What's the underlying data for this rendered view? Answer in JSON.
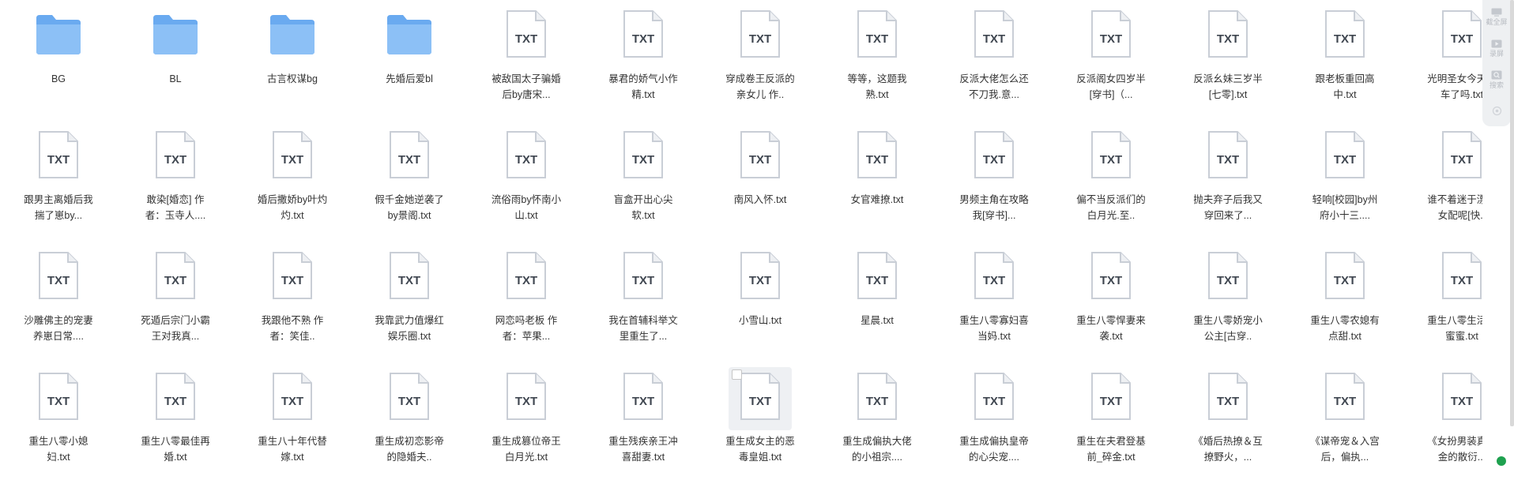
{
  "colors": {
    "folder": "#6aaaf0",
    "txt_text": "#3f4650",
    "doc_stroke": "#c9ced6"
  },
  "items": [
    {
      "type": "folder",
      "name": "BG"
    },
    {
      "type": "folder",
      "name": "BL"
    },
    {
      "type": "folder",
      "name": "古言权谋bg"
    },
    {
      "type": "folder",
      "name": "先婚后爱bl"
    },
    {
      "type": "txt",
      "name": "被敌国太子骗婚后by唐宋..."
    },
    {
      "type": "txt",
      "name": "暴君的娇气小作精.txt"
    },
    {
      "type": "txt",
      "name": "穿成卷王反派的亲女儿 作.."
    },
    {
      "type": "txt",
      "name": "等等，这题我熟.txt"
    },
    {
      "type": "txt",
      "name": "反派大佬怎么还不刀我.意..."
    },
    {
      "type": "txt",
      "name": "反派阁女四岁半[穿书]（..."
    },
    {
      "type": "txt",
      "name": "反派幺妹三岁半[七零].txt"
    },
    {
      "type": "txt",
      "name": "跟老板重回高中.txt"
    },
    {
      "type": "txt",
      "name": "光明圣女今天翻车了吗.txt"
    },
    {
      "type": "txt",
      "name": "跟男主离婚后我揣了崽by..."
    },
    {
      "type": "txt",
      "name": "敢染[婚恋] 作者：玉寺人...."
    },
    {
      "type": "txt",
      "name": "婚后撒娇by叶灼灼.txt"
    },
    {
      "type": "txt",
      "name": "假千金她逆袭了by景阁.txt"
    },
    {
      "type": "txt",
      "name": "流俗雨by怀南小山.txt"
    },
    {
      "type": "txt",
      "name": "盲盒开出心尖软.txt"
    },
    {
      "type": "txt",
      "name": "南风入怀.txt"
    },
    {
      "type": "txt",
      "name": "女官难撩.txt"
    },
    {
      "type": "txt",
      "name": "男频主角在攻略我[穿书]..."
    },
    {
      "type": "txt",
      "name": "偏不当反派们的白月光.至.."
    },
    {
      "type": "txt",
      "name": "抛夫弃子后我又穿回来了..."
    },
    {
      "type": "txt",
      "name": "轻响[校园]by州府小十三...."
    },
    {
      "type": "txt",
      "name": "谁不着迷于漂亮女配呢[快.."
    },
    {
      "type": "txt",
      "name": "沙雕佛主的宠妻养崽日常...."
    },
    {
      "type": "txt",
      "name": "死遁后宗门小霸王对我真..."
    },
    {
      "type": "txt",
      "name": "我跟他不熟 作者：笑佳.."
    },
    {
      "type": "txt",
      "name": "我靠武力值爆红娱乐圈.txt"
    },
    {
      "type": "txt",
      "name": "网恋吗老板 作者：苹果..."
    },
    {
      "type": "txt",
      "name": "我在首辅科举文里重生了..."
    },
    {
      "type": "txt",
      "name": "小雪山.txt"
    },
    {
      "type": "txt",
      "name": "星晨.txt"
    },
    {
      "type": "txt",
      "name": "重生八零寡妇喜当妈.txt"
    },
    {
      "type": "txt",
      "name": "重生八零悍妻来袭.txt"
    },
    {
      "type": "txt",
      "name": "重生八零娇宠小公主[古穿.."
    },
    {
      "type": "txt",
      "name": "重生八零农媳有点甜.txt"
    },
    {
      "type": "txt",
      "name": "重生八零生活甜蜜蜜.txt"
    },
    {
      "type": "txt",
      "name": "重生八零小媳妇.txt"
    },
    {
      "type": "txt",
      "name": "重生八零最佳再婚.txt"
    },
    {
      "type": "txt",
      "name": "重生八十年代替嫁.txt"
    },
    {
      "type": "txt",
      "name": "重生成初恋影帝的隐婚夫.."
    },
    {
      "type": "txt",
      "name": "重生成篡位帝王白月光.txt"
    },
    {
      "type": "txt",
      "name": "重生残疾亲王冲喜甜妻.txt"
    },
    {
      "type": "txt",
      "name": "重生成女主的恶毒皇姐.txt",
      "selected": true
    },
    {
      "type": "txt",
      "name": "重生成偏执大佬的小祖宗...."
    },
    {
      "type": "txt",
      "name": "重生成偏执皇帝的心尖宠...."
    },
    {
      "type": "txt",
      "name": "重生在夫君登基前_碎金.txt"
    },
    {
      "type": "txt",
      "name": "《婚后热撩＆互撩野火，..."
    },
    {
      "type": "txt",
      "name": "《谋帝宠＆入宫后，偏执..."
    },
    {
      "type": "txt",
      "name": "《女扮男装真千金的散衍..."
    }
  ],
  "txt_icon_label": "TXT",
  "side_panel": {
    "buttons": [
      {
        "icon": "screen-icon",
        "label": "截全屏"
      },
      {
        "icon": "record-icon",
        "label": "录屏"
      },
      {
        "icon": "search-icon",
        "label": "搜索"
      },
      {
        "icon": "settings-icon",
        "label": ""
      }
    ]
  }
}
